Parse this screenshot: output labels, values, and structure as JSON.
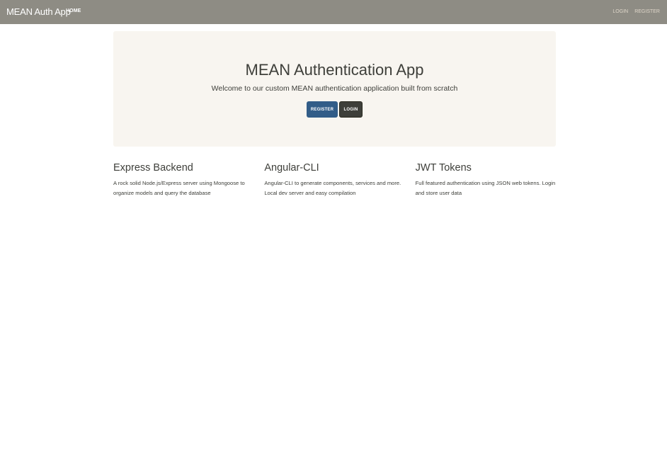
{
  "navbar": {
    "brand": "MEAN Auth App",
    "home_label": "HOME",
    "login_label": "LOGIN",
    "register_label": "REGISTER"
  },
  "jumbotron": {
    "title": "MEAN Authentication App",
    "lead": "Welcome to our custom MEAN authentication application built from scratch",
    "register_button": "REGISTER",
    "login_button": "LOGIN"
  },
  "features": [
    {
      "title": "Express Backend",
      "text": "A rock solid Node.js/Express server using Mongoose to organize models and query the database"
    },
    {
      "title": "Angular-CLI",
      "text": "Angular-CLI to generate components, services and more. Local dev server and easy compilation"
    },
    {
      "title": "JWT Tokens",
      "text": "Full featured authentication using JSON web tokens. Login and store user data"
    }
  ],
  "colors": {
    "navbar_bg": "#8e8c84",
    "jumbotron_bg": "#f8f5f0",
    "primary": "#325d88",
    "dark": "#3e3f3a"
  }
}
